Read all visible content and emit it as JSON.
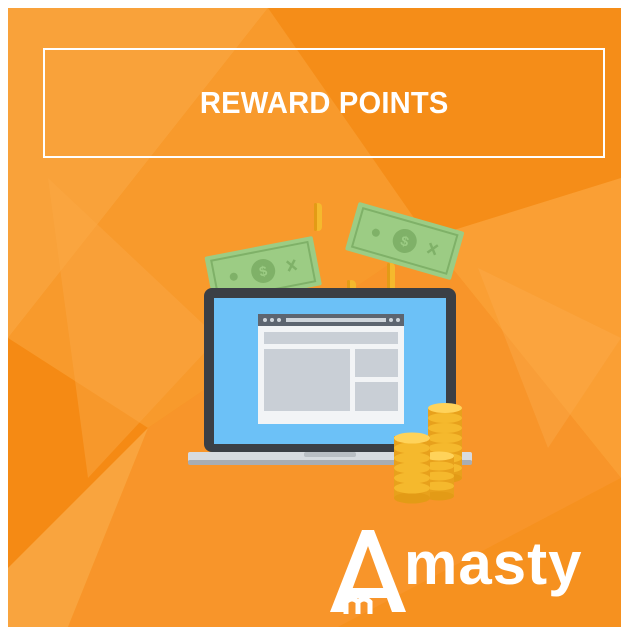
{
  "banner": {
    "title": "REWARD POINTS",
    "background_color": "#f7931e",
    "accent_colors": {
      "screen": "#6cc1f7",
      "laptop_frame": "#3b3f45",
      "banknote": "#9ccc84",
      "coin": "#f5b92d"
    }
  },
  "illustration": {
    "icons": [
      "banknote-icon",
      "coin-icon",
      "laptop-icon",
      "browser-window-icon",
      "coin-stack-icon"
    ]
  },
  "logo": {
    "wordmark": "Amasty"
  }
}
